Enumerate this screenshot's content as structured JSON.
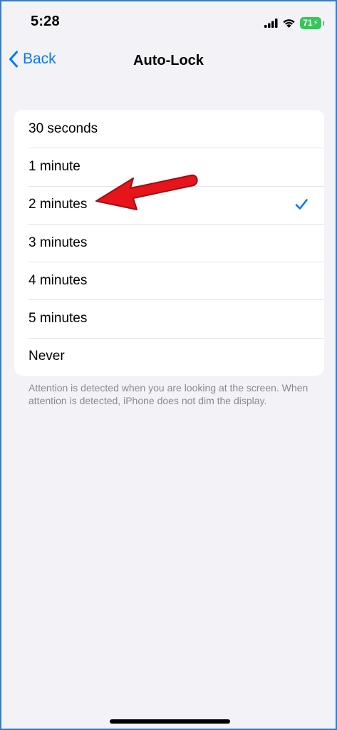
{
  "status_bar": {
    "time": "5:28",
    "battery_level": "71",
    "battery_charging": true,
    "battery_color": "#34c759"
  },
  "nav": {
    "back_label": "Back",
    "title": "Auto-Lock"
  },
  "options": [
    {
      "label": "30 seconds",
      "selected": false
    },
    {
      "label": "1 minute",
      "selected": false
    },
    {
      "label": "2 minutes",
      "selected": true
    },
    {
      "label": "3 minutes",
      "selected": false
    },
    {
      "label": "4 minutes",
      "selected": false
    },
    {
      "label": "5 minutes",
      "selected": false
    },
    {
      "label": "Never",
      "selected": false
    }
  ],
  "footer_note": "Attention is detected when you are looking at the screen. When attention is detected, iPhone does not dim the display.",
  "colors": {
    "accent": "#007aff",
    "annotation_arrow": "#e8141b",
    "background": "#f2f2f7"
  },
  "icons": {
    "back": "chevron-left-icon",
    "selected": "checkmark-icon",
    "annotation": "red-arrow-icon"
  }
}
